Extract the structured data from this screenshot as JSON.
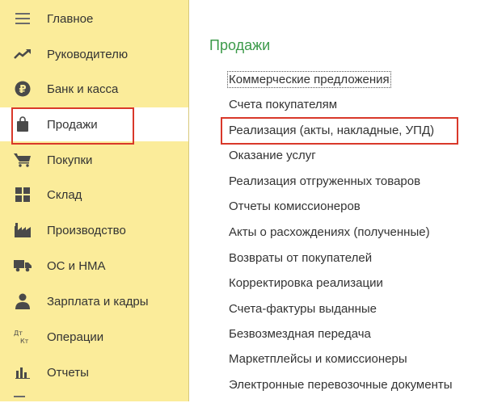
{
  "sidebar": {
    "items": [
      {
        "label": "Главное",
        "icon": "menu-lines-icon"
      },
      {
        "label": "Руководителю",
        "icon": "trend-up-icon"
      },
      {
        "label": "Банк и касса",
        "icon": "ruble-coin-icon"
      },
      {
        "label": "Продажи",
        "icon": "shopping-bag-icon",
        "active": true
      },
      {
        "label": "Покупки",
        "icon": "cart-icon"
      },
      {
        "label": "Склад",
        "icon": "warehouse-grid-icon"
      },
      {
        "label": "Производство",
        "icon": "factory-icon"
      },
      {
        "label": "ОС и НМА",
        "icon": "truck-icon"
      },
      {
        "label": "Зарплата и кадры",
        "icon": "person-icon"
      },
      {
        "label": "Операции",
        "icon": "debit-credit-icon"
      },
      {
        "label": "Отчеты",
        "icon": "bar-chart-icon"
      }
    ]
  },
  "content": {
    "title": "Продажи",
    "links": [
      "Коммерческие предложения",
      "Счета покупателям",
      "Реализация (акты, накладные, УПД)",
      "Оказание услуг",
      "Реализация отгруженных товаров",
      "Отчеты комиссионеров",
      "Акты о расхождениях (полученные)",
      "Возвраты от покупателей",
      "Корректировка реализации",
      "Счета-фактуры выданные",
      "Безвозмездная передача",
      "Маркетплейсы и комиссионеры",
      "Электронные перевозочные документы"
    ]
  },
  "colors": {
    "sidebar_bg": "#fbec9a",
    "title_green": "#3c9a4a",
    "highlight_red": "#d9382a",
    "icon_dark": "#4a4a4a"
  }
}
